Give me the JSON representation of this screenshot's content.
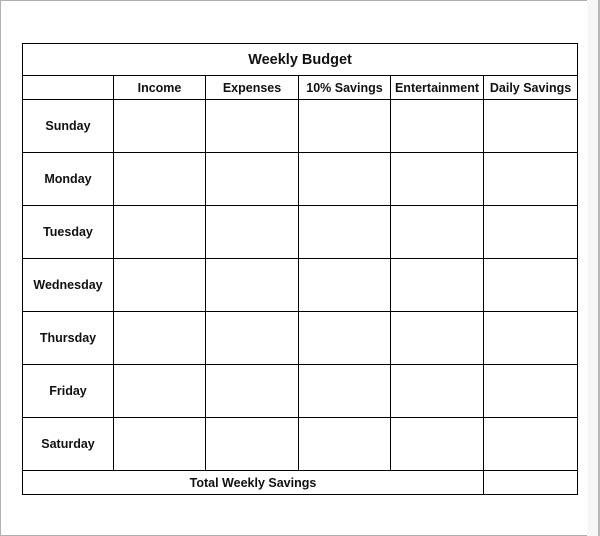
{
  "document": {
    "title": "Weekly Budget",
    "columns": [
      "",
      "Income",
      "Expenses",
      "10% Savings",
      "Entertainment",
      "Daily Savings"
    ],
    "days": [
      "Sunday",
      "Monday",
      "Tuesday",
      "Wednesday",
      "Thursday",
      "Friday",
      "Saturday"
    ],
    "total_label": "Total Weekly Savings"
  }
}
